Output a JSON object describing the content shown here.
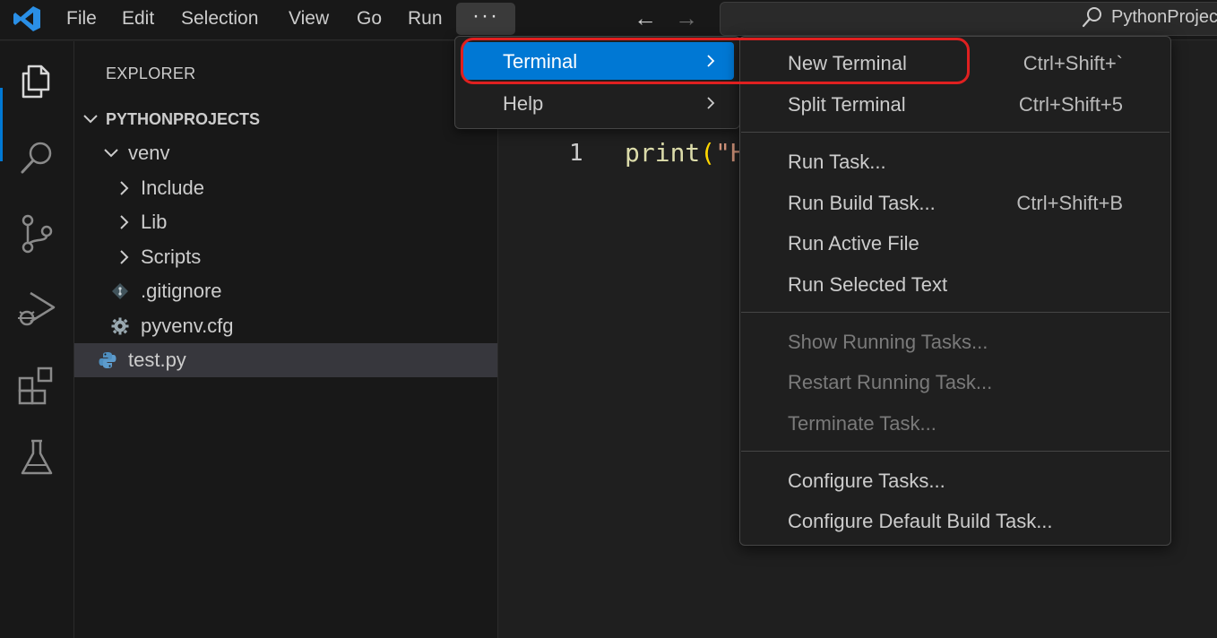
{
  "titlebar": {
    "menus": [
      "File",
      "Edit",
      "Selection",
      "View",
      "Go",
      "Run"
    ],
    "more_label": "···",
    "back_arrow": "←",
    "forward_arrow": "→",
    "search_text": "PythonProjec"
  },
  "sidebar": {
    "title": "EXPLORER",
    "tree": [
      {
        "label": "PYTHONPROJECTS",
        "kind": "folder-open",
        "level": 0
      },
      {
        "label": "venv",
        "kind": "folder-open",
        "level": 1
      },
      {
        "label": "Include",
        "kind": "folder-closed",
        "level": 2
      },
      {
        "label": "Lib",
        "kind": "folder-closed",
        "level": 2
      },
      {
        "label": "Scripts",
        "kind": "folder-closed",
        "level": 2
      },
      {
        "label": ".gitignore",
        "kind": "git-file-icon",
        "level": 2
      },
      {
        "label": "pyvenv.cfg",
        "kind": "gear-file-icon",
        "level": 2
      },
      {
        "label": "test.py",
        "kind": "python-file-icon",
        "level": 1,
        "selected": true
      }
    ]
  },
  "editor": {
    "line_number": "1",
    "code_func": "print",
    "code_paren": "(",
    "code_str": "\"H"
  },
  "more_menu": {
    "items": [
      {
        "label": "Terminal",
        "active": true
      },
      {
        "label": "Help",
        "active": false
      }
    ]
  },
  "terminal_menu": {
    "items": [
      {
        "label": "New Terminal",
        "shortcut": "Ctrl+Shift+`",
        "disabled": false
      },
      {
        "label": "Split Terminal",
        "shortcut": "Ctrl+Shift+5",
        "disabled": false
      },
      {
        "label": "Run Task...",
        "shortcut": "",
        "disabled": false
      },
      {
        "label": "Run Build Task...",
        "shortcut": "Ctrl+Shift+B",
        "disabled": false
      },
      {
        "label": "Run Active File",
        "shortcut": "",
        "disabled": false
      },
      {
        "label": "Run Selected Text",
        "shortcut": "",
        "disabled": false
      },
      {
        "label": "Show Running Tasks...",
        "shortcut": "",
        "disabled": true
      },
      {
        "label": "Restart Running Task...",
        "shortcut": "",
        "disabled": true
      },
      {
        "label": "Terminate Task...",
        "shortcut": "",
        "disabled": true
      },
      {
        "label": "Configure Tasks...",
        "shortcut": "",
        "disabled": false
      },
      {
        "label": "Configure Default Build Task...",
        "shortcut": "",
        "disabled": false
      }
    ]
  },
  "colors": {
    "accent": "#0078d4",
    "highlight_ring": "#e02020"
  }
}
